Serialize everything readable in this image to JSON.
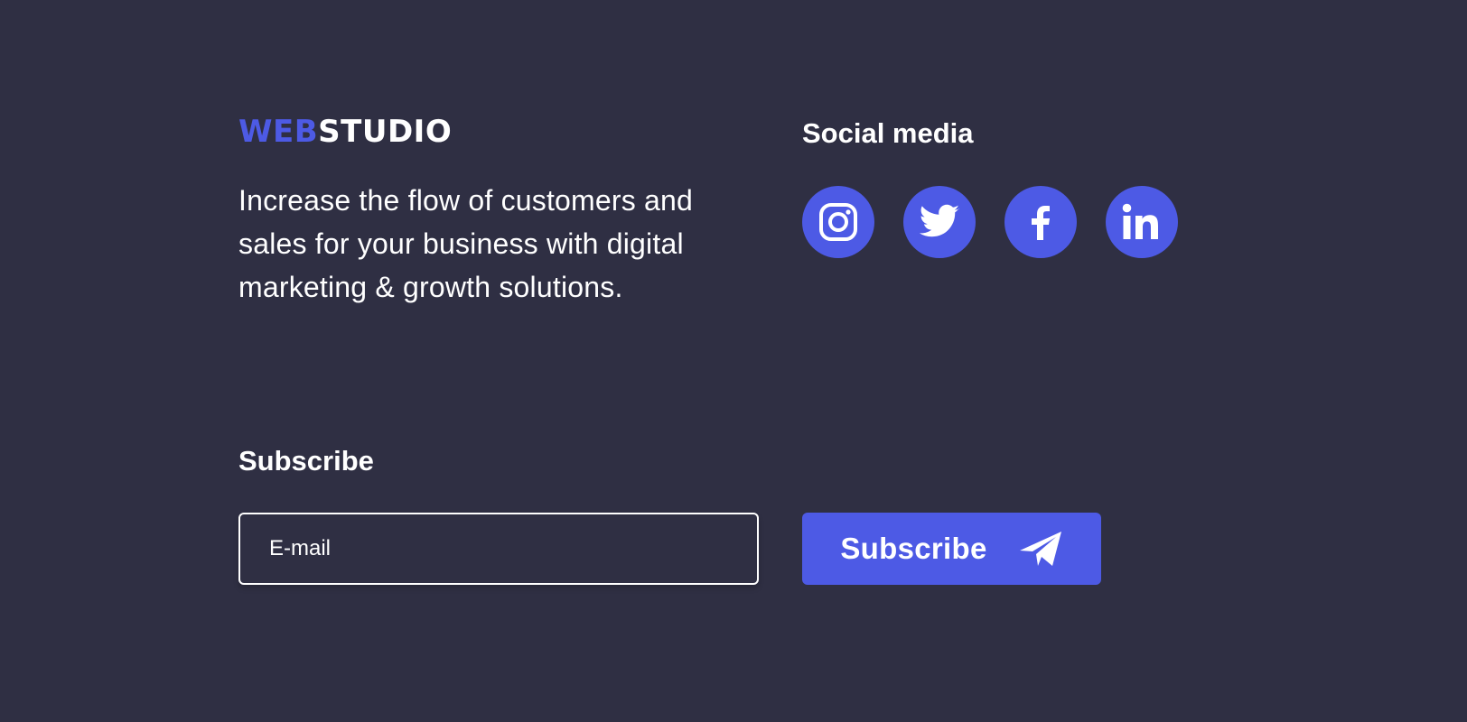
{
  "brand": {
    "logo_accent": "WEB",
    "logo_main": "STUDIO",
    "accent_color": "#4d5ae5"
  },
  "about": {
    "tagline": "Increase the flow of customers and sales for your business with digital marketing & growth solutions."
  },
  "social": {
    "title": "Social media",
    "links": [
      {
        "icon": "instagram-icon"
      },
      {
        "icon": "twitter-icon"
      },
      {
        "icon": "facebook-icon"
      },
      {
        "icon": "linkedin-icon"
      }
    ]
  },
  "subscribe": {
    "title": "Subscribe",
    "email_placeholder": "E-mail",
    "email_value": "",
    "button_label": "Subscribe",
    "button_icon": "send-icon"
  },
  "colors": {
    "background": "#2f2f43",
    "accent": "#4d5ae5",
    "text": "#ffffff"
  }
}
